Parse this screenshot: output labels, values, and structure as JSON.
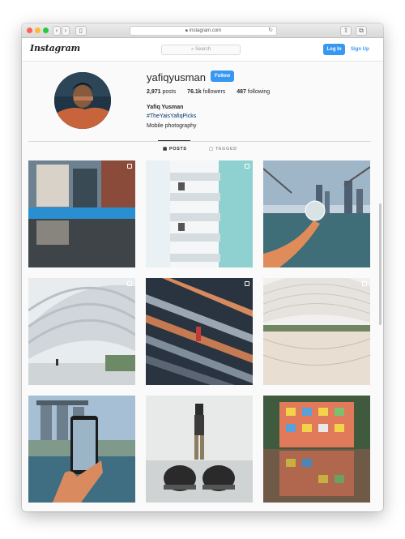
{
  "browser": {
    "url": "instagram.com"
  },
  "header": {
    "logo": "Instagram",
    "search_placeholder": "Search",
    "login_label": "Log In",
    "signup_label": "Sign Up"
  },
  "profile": {
    "username": "yafiqyusman",
    "follow_label": "Follow",
    "stats": [
      {
        "value": "2,971",
        "label": "posts"
      },
      {
        "value": "76.1k",
        "label": "followers"
      },
      {
        "value": "487",
        "label": "following"
      }
    ],
    "full_name": "Yafiq Yusman",
    "hashtag": "#TheYaisYafiqPicks",
    "bio": "Mobile photography"
  },
  "tabs": [
    {
      "label": "POSTS",
      "icon": "grid-icon",
      "active": true
    },
    {
      "label": "TAGGED",
      "icon": "tag-icon",
      "active": false
    }
  ],
  "posts": [
    {
      "subject": "building reflection",
      "multi": true
    },
    {
      "subject": "white balconies",
      "multi": true
    },
    {
      "subject": "crystal ball skyline",
      "multi": false
    },
    {
      "subject": "curved canopy",
      "multi": true
    },
    {
      "subject": "escalator lines",
      "multi": true
    },
    {
      "subject": "dome reflection",
      "multi": true
    },
    {
      "subject": "phone framing hotel",
      "multi": false
    },
    {
      "subject": "sneakers perspective",
      "multi": false
    },
    {
      "subject": "colorful building reflection",
      "multi": false
    }
  ],
  "colors": {
    "accent": "#3897f0",
    "hashtag": "#003569",
    "text": "#262626"
  }
}
